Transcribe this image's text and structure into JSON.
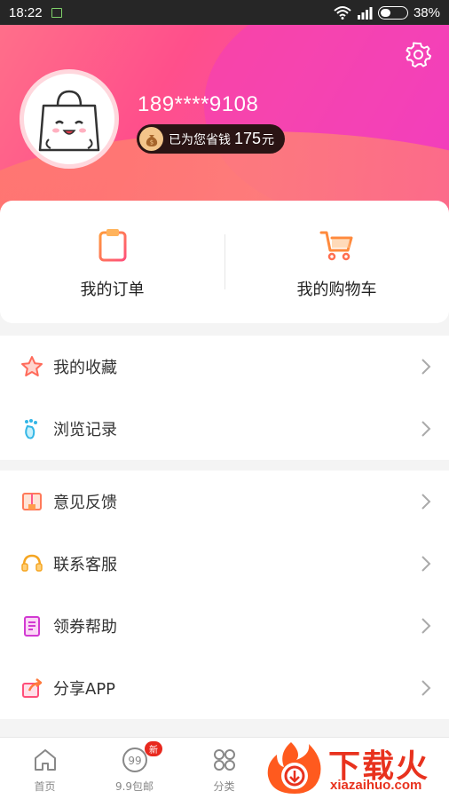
{
  "status_bar": {
    "time": "18:22",
    "battery": "38%",
    "battery_fraction": 0.38
  },
  "profile": {
    "phone": "189****9108",
    "saved_label": "已为您省钱",
    "saved_amount": "175",
    "saved_unit": "元"
  },
  "shortcuts": [
    {
      "label": "我的订单",
      "icon": "order-clipboard-icon"
    },
    {
      "label": "我的购物车",
      "icon": "shopping-cart-icon"
    }
  ],
  "menu_group_1": [
    {
      "label": "我的收藏",
      "icon": "star-icon"
    },
    {
      "label": "浏览记录",
      "icon": "footprint-icon"
    }
  ],
  "menu_group_2": [
    {
      "label": "意见反馈",
      "icon": "feedback-book-icon"
    },
    {
      "label": "联系客服",
      "icon": "headset-icon"
    },
    {
      "label": "领券帮助",
      "icon": "coupon-doc-icon"
    },
    {
      "label": "分享APP",
      "icon": "share-icon"
    }
  ],
  "tabs": [
    {
      "label": "首页",
      "icon": "home-icon"
    },
    {
      "label": "9.9包邮",
      "icon": "nine-nine-icon",
      "badge": "新"
    },
    {
      "label": "分类",
      "icon": "category-icon"
    }
  ],
  "watermark": {
    "brand": "下载火",
    "site": "xiazaihuo.com"
  },
  "colors": {
    "header_pink": "#ff4f8b",
    "header_magenta": "#f03fc0",
    "accent_orange": "#ff8a3d",
    "badge_red": "#e8281e"
  }
}
